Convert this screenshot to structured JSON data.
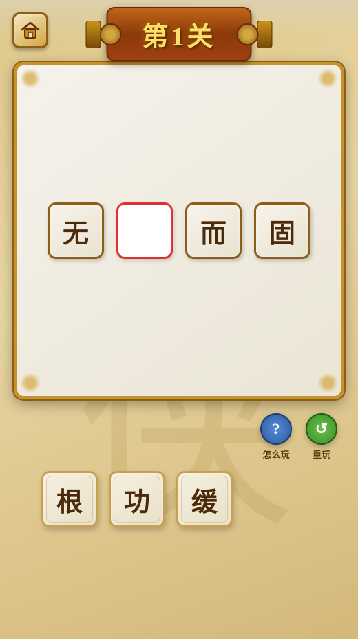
{
  "app": {
    "title": "第1关",
    "bg_color": "#e8d5a3"
  },
  "header": {
    "home_label": "home",
    "title": "第1关"
  },
  "game": {
    "slots": [
      {
        "id": 1,
        "char": "无",
        "filled": true
      },
      {
        "id": 2,
        "char": "",
        "filled": false
      },
      {
        "id": 3,
        "char": "而",
        "filled": true
      },
      {
        "id": 4,
        "char": "固",
        "filled": true
      }
    ],
    "answer_tiles": [
      {
        "id": 1,
        "char": "根"
      },
      {
        "id": 2,
        "char": "功"
      },
      {
        "id": 3,
        "char": "缓"
      }
    ]
  },
  "controls": {
    "help_label": "怎么玩",
    "restart_label": "重玩"
  },
  "icons": {
    "home": "⌂",
    "help": "?",
    "restart": "↺"
  }
}
